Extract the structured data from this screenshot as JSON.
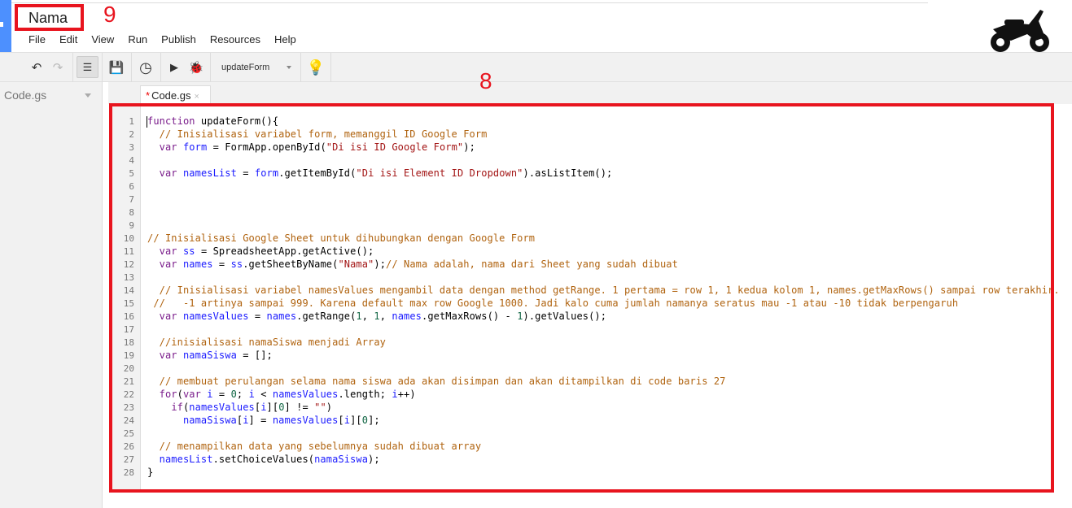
{
  "project_title": "Nama",
  "menu": [
    "File",
    "Edit",
    "View",
    "Run",
    "Publish",
    "Resources",
    "Help"
  ],
  "toolbar": {
    "function_select": "updateForm"
  },
  "sidebar": {
    "file": "Code.gs"
  },
  "tab": {
    "modified_marker": "*",
    "label": "Code.gs",
    "close": "×"
  },
  "annotations": {
    "title_marker": "9",
    "editor_marker": "8"
  },
  "colors": {
    "annotation": "#e8141e",
    "keyword": "#7a1c8b",
    "variable": "#1a1aff",
    "comment": "#b0630f",
    "string": "#a31515"
  },
  "code_lines": [
    "function updateForm(){",
    "  // Inisialisasi variabel form, memanggil ID Google Form",
    "  var form = FormApp.openById(\"Di isi ID Google Form\");",
    "",
    "  var namesList = form.getItemById(\"Di isi Element ID Dropdown\").asListItem();",
    "",
    "",
    "",
    "",
    "// Inisialisasi Google Sheet untuk dihubungkan dengan Google Form",
    "  var ss = SpreadsheetApp.getActive();",
    "  var names = ss.getSheetByName(\"Nama\");// Nama adalah, nama dari Sheet yang sudah dibuat",
    "",
    "  // Inisialisasi variabel namesValues mengambil data dengan method getRange. 1 pertama = row 1, 1 kedua kolom 1, names.getMaxRows() sampai row terakhir.",
    " //   -1 artinya sampai 999. Karena default max row Google 1000. Jadi kalo cuma jumlah namanya seratus mau -1 atau -10 tidak berpengaruh",
    "  var namesValues = names.getRange(1, 1, names.getMaxRows() - 1).getValues();",
    "",
    "  //inisialisasi namaSiswa menjadi Array",
    "  var namaSiswa = [];",
    "",
    "  // membuat perulangan selama nama siswa ada akan disimpan dan akan ditampilkan di code baris 27",
    "  for(var i = 0; i < namesValues.length; i++)",
    "    if(namesValues[i][0] != \"\")",
    "      namaSiswa[i] = namesValues[i][0];",
    "",
    "  // menampilkan data yang sebelumnya sudah dibuat array",
    "  namesList.setChoiceValues(namaSiswa);",
    "}"
  ]
}
